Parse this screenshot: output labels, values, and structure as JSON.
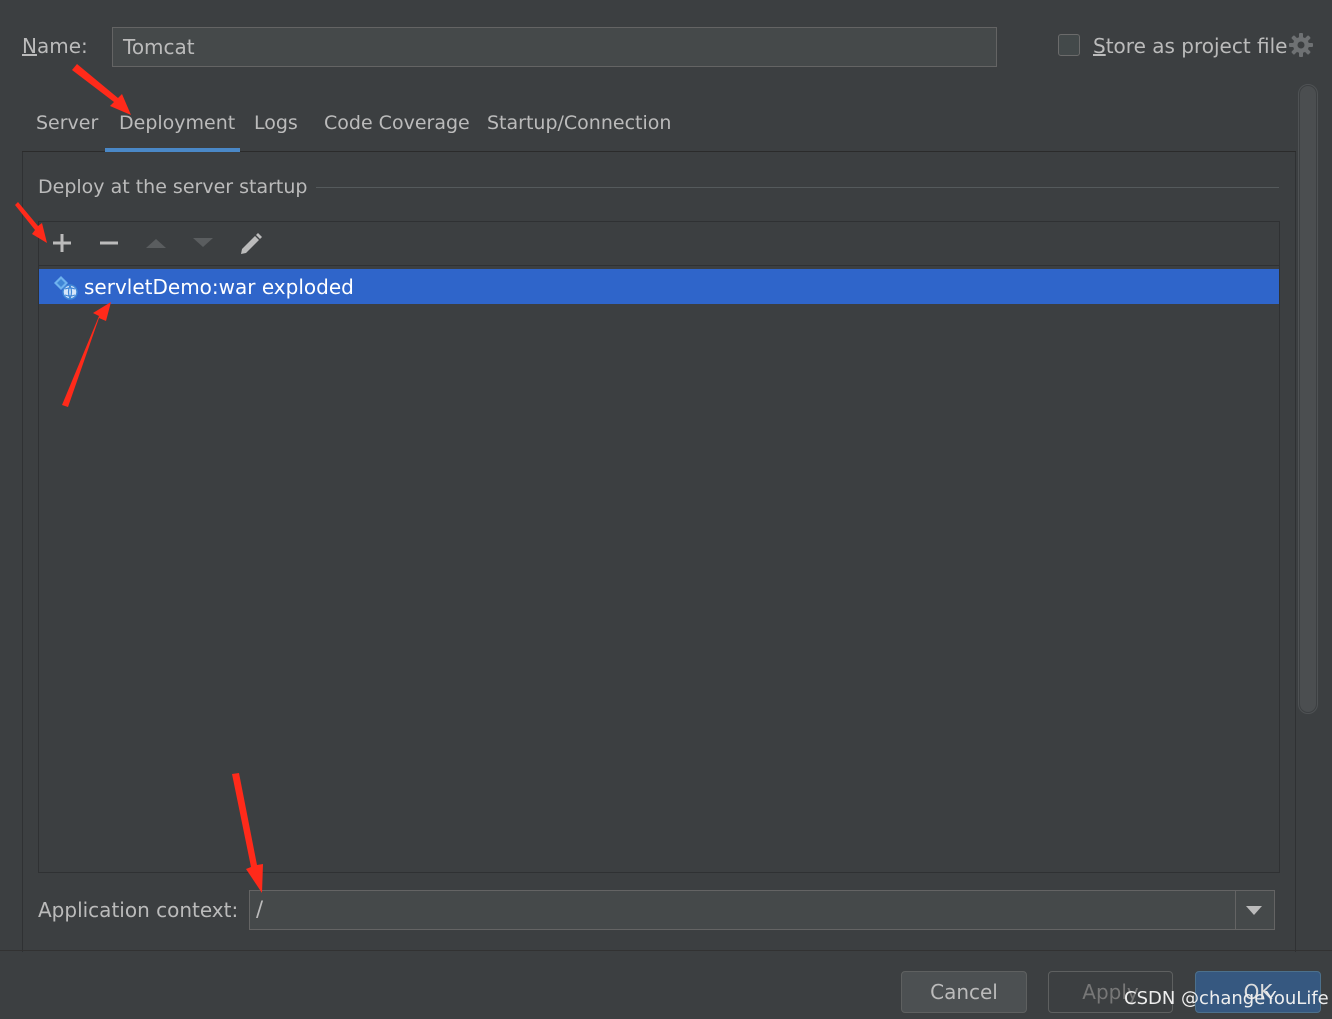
{
  "dialog": {
    "name_label": "Name:",
    "name_value": "Tomcat",
    "store_label": "Store as project file",
    "store_checked": false
  },
  "tabs": [
    {
      "label": "Server",
      "active": false
    },
    {
      "label": "Deployment",
      "active": true
    },
    {
      "label": "Logs",
      "active": false
    },
    {
      "label": "Code Coverage",
      "active": false
    },
    {
      "label": "Startup/Connection",
      "active": false
    }
  ],
  "deployment": {
    "section_title": "Deploy at the server startup",
    "toolbar": {
      "add_icon": "plus-icon",
      "remove_icon": "minus-icon",
      "up_icon": "arrow-up-icon",
      "down_icon": "arrow-down-icon",
      "edit_icon": "pencil-icon"
    },
    "artifacts": [
      {
        "label": "servletDemo:war exploded",
        "icon": "artifact-icon",
        "selected": true
      }
    ],
    "context_label": "Application context:",
    "context_value": "/"
  },
  "footer": {
    "cancel_label": "Cancel",
    "apply_label": "Apply",
    "ok_label": "OK"
  },
  "watermark": "CSDN @changeYouLife",
  "colors": {
    "background": "#3c3f41",
    "selection": "#2f65ca",
    "tab_underline": "#4a88c7",
    "annotation_arrow": "#ff2a1a"
  }
}
